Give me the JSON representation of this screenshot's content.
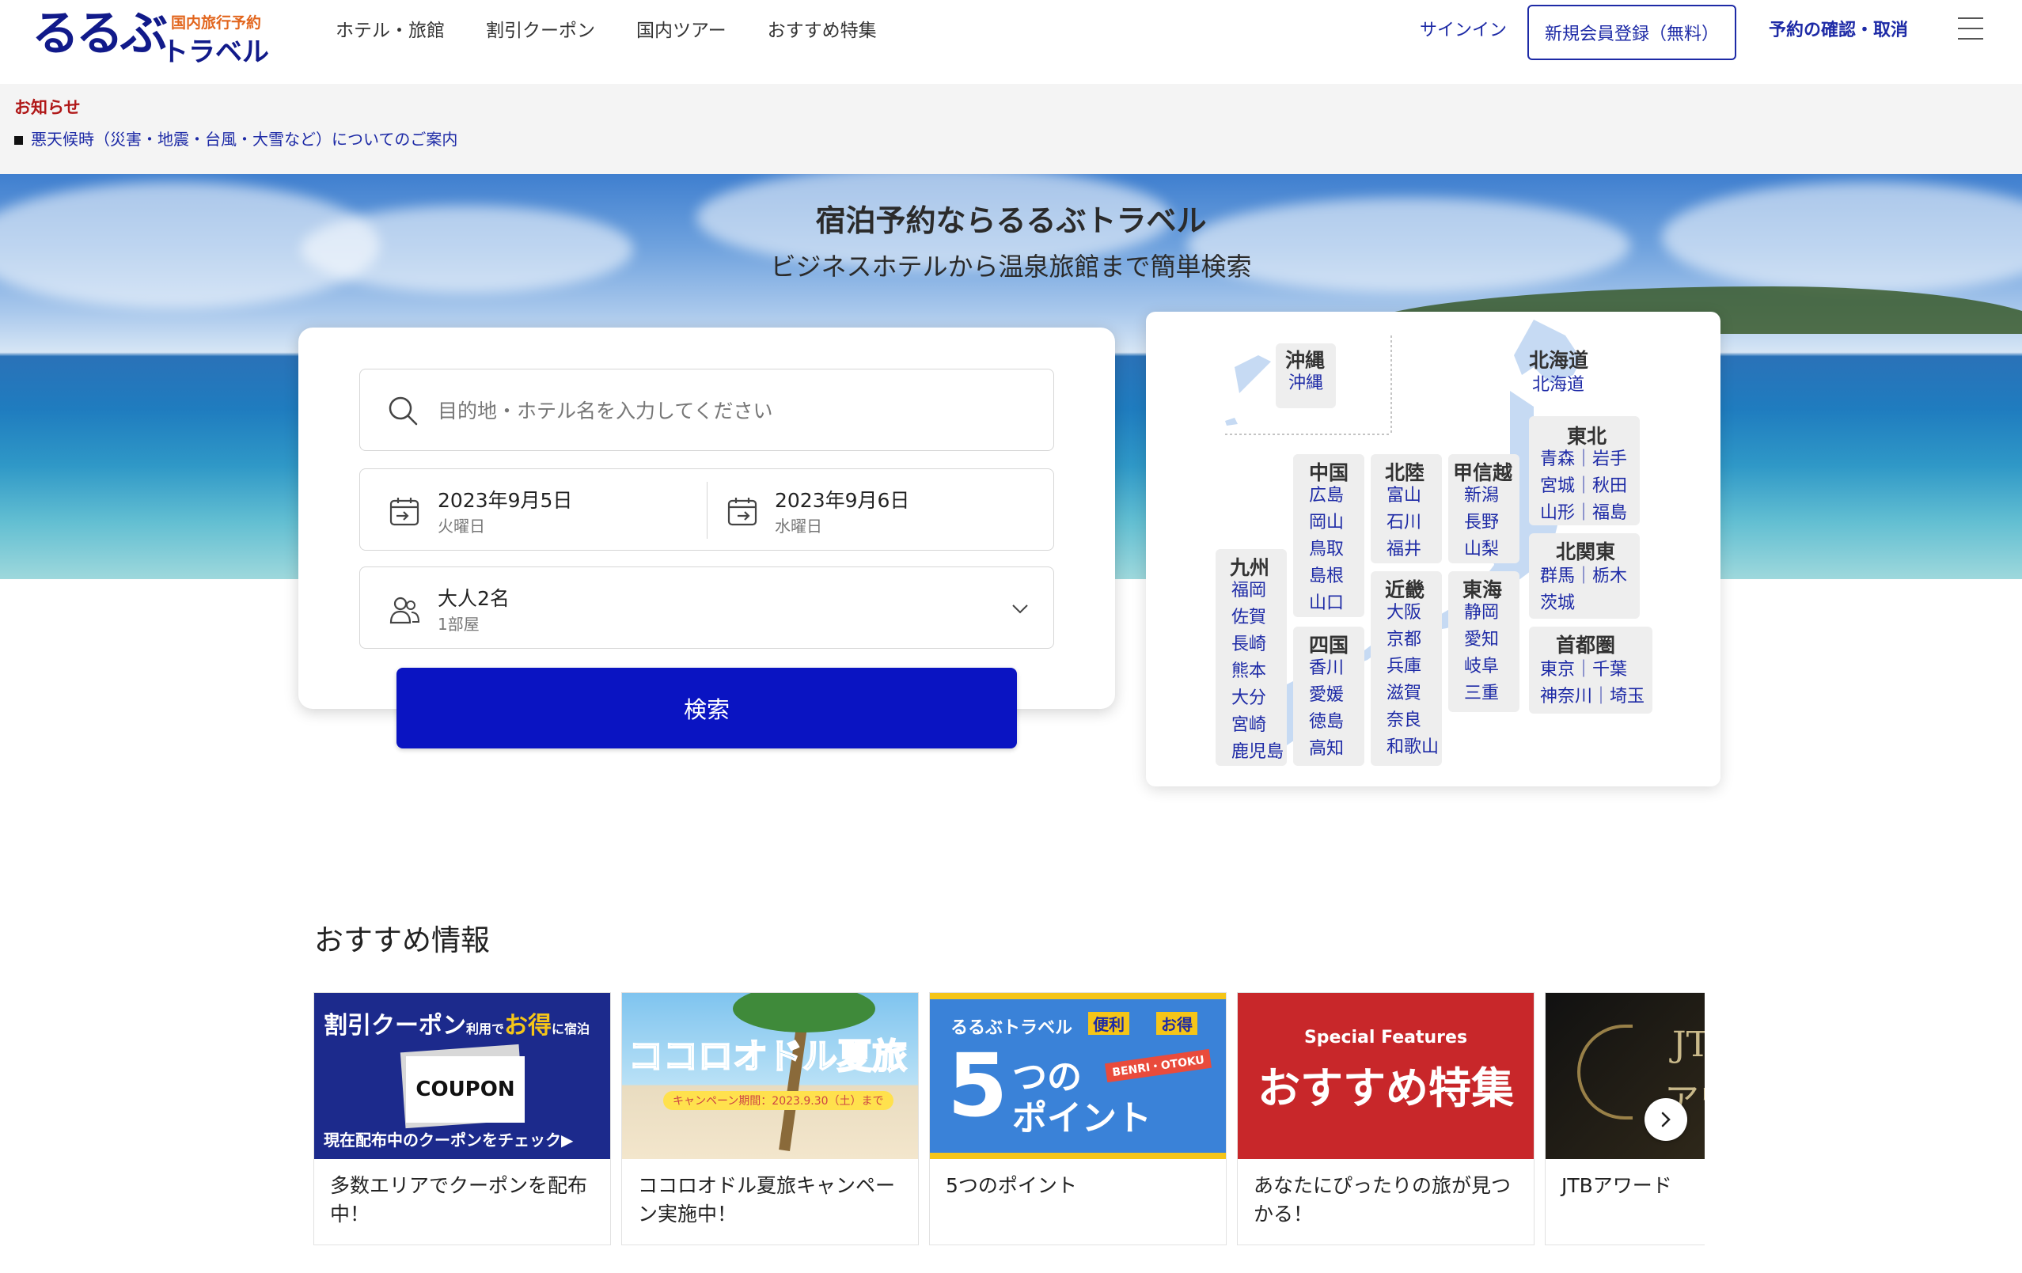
{
  "header": {
    "logo_main": "るるぶ",
    "logo_sub": "国内旅行予約",
    "logo_travel": "トラベル",
    "nav": [
      "ホテル・旅館",
      "割引クーポン",
      "国内ツアー",
      "おすすめ特集"
    ],
    "signin": "サインイン",
    "register": "新規会員登録（無料）",
    "confirm": "予約の確認・取消"
  },
  "notice": {
    "title": "お知らせ",
    "item": "悪天候時（災害・地震・台風・大雪など）についてのご案内"
  },
  "hero": {
    "title": "宿泊予約ならるるぶトラベル",
    "subtitle": "ビジネスホテルから温泉旅館まで簡単検索"
  },
  "search": {
    "placeholder": "目的地・ホテル名を入力してください",
    "checkin_date": "2023年9月5日",
    "checkin_day": "火曜日",
    "checkout_date": "2023年9月6日",
    "checkout_day": "水曜日",
    "guests": "大人2名",
    "rooms": "1部屋",
    "button": "検索"
  },
  "map": {
    "okinawa": {
      "name": "沖縄",
      "prefs": [
        "沖縄"
      ]
    },
    "hokkaido": {
      "name": "北海道",
      "prefs": [
        "北海道"
      ]
    },
    "tohoku": {
      "name": "東北",
      "rows": [
        "青森｜岩手",
        "宮城｜秋田",
        "山形｜福島"
      ]
    },
    "chugoku": {
      "name": "中国",
      "prefs": [
        "広島",
        "岡山",
        "鳥取",
        "島根",
        "山口"
      ]
    },
    "hokuriku": {
      "name": "北陸",
      "prefs": [
        "富山",
        "石川",
        "福井"
      ]
    },
    "koshinetsu": {
      "name": "甲信越",
      "prefs": [
        "新潟",
        "長野",
        "山梨"
      ]
    },
    "kitakanto": {
      "name": "北関東",
      "rows": [
        "群馬｜栃木",
        "茨城"
      ]
    },
    "kyushu": {
      "name": "九州",
      "prefs": [
        "福岡",
        "佐賀",
        "長崎",
        "熊本",
        "大分",
        "宮崎",
        "鹿児島"
      ]
    },
    "kinki": {
      "name": "近畿",
      "prefs": [
        "大阪",
        "京都",
        "兵庫",
        "滋賀",
        "奈良",
        "和歌山"
      ]
    },
    "tokai": {
      "name": "東海",
      "prefs": [
        "静岡",
        "愛知",
        "岐阜",
        "三重"
      ]
    },
    "shikoku": {
      "name": "四国",
      "prefs": [
        "香川",
        "愛媛",
        "徳島",
        "高知"
      ]
    },
    "shutoken": {
      "name": "首都圏",
      "rows": [
        "東京｜千葉",
        "神奈川｜埼玉"
      ]
    }
  },
  "recommend": {
    "title": "おすすめ情報",
    "cards": [
      {
        "text": "多数エリアでクーポンを配布中！",
        "banner_top": "割引クーポン",
        "banner_small": "利用で",
        "banner_accent": "お得",
        "banner_small2": "に宿泊",
        "banner_badge": "COUPON",
        "banner_bottom": "現在配布中のクーポンをチェック▶"
      },
      {
        "text": "ココロオドル夏旅キャンペーン実施中！",
        "banner_title": "ココロオドル夏旅",
        "banner_note": "キャンペーン期間：2023.9.30（土）まで"
      },
      {
        "text": "5つのポイント",
        "banner_top": "るるぶトラベル",
        "banner_tag1": "便利",
        "banner_tag2": "お得",
        "banner_big": "5",
        "banner_mid": "つの",
        "banner_mid2": "ポイント",
        "banner_label": "BENRI・OTOKU"
      },
      {
        "text": "あなたにぴったりの旅が見つかる！",
        "banner_small": "Special Features",
        "banner_big": "おすすめ特集"
      },
      {
        "text": "JTBアワード",
        "banner_big": "JTB",
        "banner_big2": "アワード"
      }
    ]
  },
  "colors": {
    "brand": "#111a8a",
    "link": "#1d2aa6",
    "search_button": "#0a14c2",
    "notice_title": "#b01818"
  }
}
